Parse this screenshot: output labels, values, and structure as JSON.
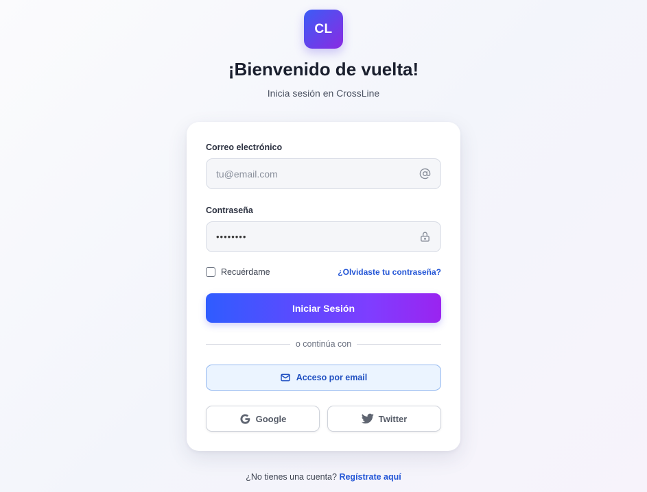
{
  "brand": {
    "logo_text": "CL"
  },
  "header": {
    "title": "¡Bienvenido de vuelta!",
    "subtitle": "Inicia sesión en CrossLine"
  },
  "form": {
    "email_label": "Correo electrónico",
    "email_placeholder": "tu@email.com",
    "email_value": "",
    "email_icon": "at-sign-icon",
    "password_label": "Contraseña",
    "password_value": "••••••••",
    "password_icon": "lock-icon",
    "remember_label": "Recuérdame",
    "remember_checked": false,
    "forgot_link": "¿Olvidaste tu contraseña?",
    "submit_label": "Iniciar Sesión"
  },
  "alt_login": {
    "divider_text": "o continúa con",
    "email_access_label": "Acceso por email",
    "email_access_icon": "mail-icon",
    "google_label": "Google",
    "twitter_label": "Twitter"
  },
  "footer": {
    "prompt": "¿No tienes una cuenta?",
    "register_link": "Regístrate aquí"
  },
  "colors": {
    "accent_start": "#2f5cff",
    "accent_end": "#9a24f0",
    "link": "#2456d6"
  }
}
